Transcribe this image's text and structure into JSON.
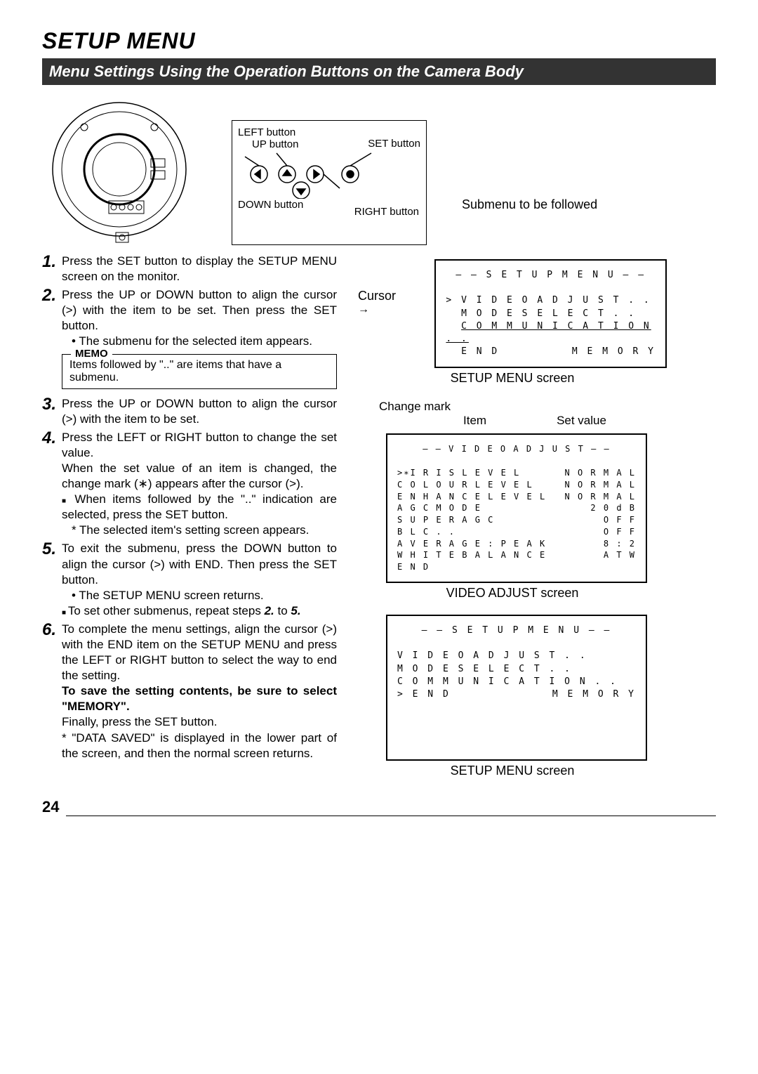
{
  "heading": "SETUP MENU",
  "subheading": "Menu Settings Using the Operation Buttons on the Camera Body",
  "button_labels": {
    "left": "LEFT button",
    "up": "UP button",
    "set": "SET button",
    "right": "RIGHT button",
    "down": "DOWN button"
  },
  "submenu_follow": "Submenu to be followed",
  "steps": {
    "s1": "Press the SET button to display the SETUP MENU screen on the monitor.",
    "s2": "Press the UP or DOWN button to align the cursor (>) with the item to be set. Then press the SET button.",
    "s2b": "• The submenu for the selected item appears.",
    "memo_title": "MEMO",
    "memo": "Items followed by \"..\" are items that have a submenu.",
    "s3": "Press the UP or DOWN button to align the cursor (>) with the item to be set.",
    "s4": "Press the LEFT or RIGHT button to change the set value.",
    "s4b": "When the set value of an item is changed, the change mark (∗) appears after the cursor (>).",
    "s4c": "When items followed by the \"..\" indication are selected, press the SET button.",
    "s4d": "* The selected item's setting screen appears.",
    "s5": "To exit the submenu, press the DOWN button to align the cursor (>) with END. Then press the SET button.",
    "s5b": "• The SETUP MENU screen returns.",
    "s5c": "To set other submenus, repeat steps",
    "s5d": "2.",
    "s5e": " to ",
    "s5f": "5.",
    "s6": "To complete the menu settings, align the cursor (>) with the END item on the SETUP MENU and press the LEFT or RIGHT button to select the way to end the setting.",
    "s6b": "To save the setting contents, be sure to select \"MEMORY\".",
    "s6c": "Finally, press the SET button.",
    "s6d": "* \"DATA SAVED\" is displayed in the lower part of the screen, and then the normal screen returns."
  },
  "right": {
    "cursor": "Cursor",
    "screen1_title": "– – S E T U P  M E N U – –",
    "screen1_l1": "V I D E O  A D J U S T . .",
    "screen1_l2": "M O D E  S E L E C T . .",
    "screen1_l3": "C O M M U N I C A T I O N . .",
    "screen1_l4a": "E N D",
    "screen1_l4b": "M E M O R Y",
    "screen1_label": "SETUP MENU screen",
    "change_mark": "Change mark",
    "item": "Item",
    "set_value": "Set value",
    "screen2_title": "– – V I D E O  A D J U S T – –",
    "va": {
      "r1a": ">∗I R I S  L E V E L",
      "r1b": "N O R M A L",
      "r2a": "  C O L O U R  L E V E L",
      "r2b": "N O R M A L",
      "r3a": "  E N H A N C E  L E V E L",
      "r3b": "N O R M A L",
      "r4a": "  A G C  M O D E",
      "r4b": "2 0 d B",
      "r5a": "  S U P E R  A G C",
      "r5b": "O F F",
      "r6a": "  B L C . .",
      "r6b": "O F F",
      "r7a": "  A V E R A G E : P E A K",
      "r7b": "8 : 2",
      "r8a": "  W H I T E  B A L A N C E",
      "r8b": "A T W",
      "r9a": "  E N D",
      "r9b": ""
    },
    "screen2_label": "VIDEO ADJUST screen",
    "screen3_l1": "  V I D E O  A D J U S T . .",
    "screen3_l2": "  M O D E  S E L E C T . .",
    "screen3_l3": "  C O M M U N I C A T I O N . .",
    "screen3_l4a": "> E N D",
    "screen3_l4b": "M E M O R Y",
    "screen3_label": "SETUP MENU screen"
  },
  "page": "24"
}
